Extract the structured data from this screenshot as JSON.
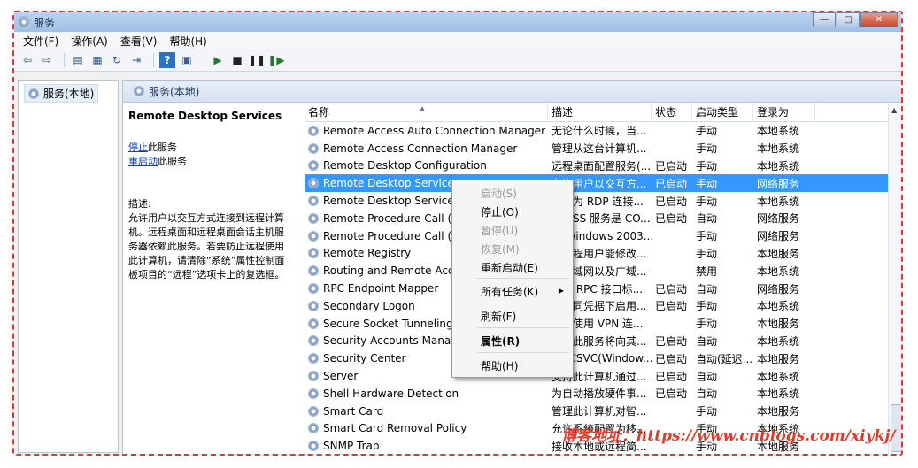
{
  "window": {
    "title": "服务",
    "btn_min": "—",
    "btn_max": "□",
    "btn_close": "✕"
  },
  "menu": [
    "文件(F)",
    "操作(A)",
    "查看(V)",
    "帮助(H)"
  ],
  "tree": {
    "root_label": "服务(本地)"
  },
  "pane": {
    "header": "服务(本地)",
    "selected_service": "Remote Desktop Services",
    "link_stop": "停止",
    "link_stop_suffix": "此服务",
    "link_restart": "重启动",
    "link_restart_suffix": "此服务",
    "desc_label": "描述:",
    "desc_text": "允许用户以交互方式连接到远程计算机。远程桌面和远程桌面会话主机服务器依赖此服务。若要防止远程使用此计算机，请清除“系统”属性控制面板项目的“远程”选项卡上的复选框。"
  },
  "columns": [
    "名称",
    "描述",
    "状态",
    "启动类型",
    "登录为"
  ],
  "rows": [
    {
      "name": "Remote Access Auto Connection Manager",
      "desc": "无论什么时候，当...",
      "status": "",
      "startup": "手动",
      "logon": "本地系统"
    },
    {
      "name": "Remote Access Connection Manager",
      "desc": "管理从这台计算机...",
      "status": "",
      "startup": "手动",
      "logon": "本地系统"
    },
    {
      "name": "Remote Desktop Configuration",
      "desc": "远程桌面配置服务(...",
      "status": "已启动",
      "startup": "手动",
      "logon": "本地系统"
    },
    {
      "name": "Remote Desktop Services",
      "desc": "允许用户以交互方...",
      "status": "已启动",
      "startup": "手动",
      "logon": "网络服务",
      "selected": true
    },
    {
      "name": "Remote Desktop Services U",
      "desc": "允许为 RDP 连接...",
      "status": "已启动",
      "startup": "手动",
      "logon": "本地系统"
    },
    {
      "name": "Remote Procedure Call (RP",
      "desc": "RPCSS 服务是 CO...",
      "status": "已启动",
      "startup": "自动",
      "logon": "网络服务"
    },
    {
      "name": "Remote Procedure Call (RP",
      "desc": "在 Windows 2003...",
      "status": "",
      "startup": "手动",
      "logon": "网络服务"
    },
    {
      "name": "Remote Registry",
      "desc": "使远程用户能修改...",
      "status": "",
      "startup": "手动",
      "logon": "本地服务"
    },
    {
      "name": "Routing and Remote Access",
      "desc": "在局域网以及广域...",
      "status": "",
      "startup": "禁用",
      "logon": "本地系统"
    },
    {
      "name": "RPC Endpoint Mapper",
      "desc": "解析 RPC 接口标...",
      "status": "已启动",
      "startup": "自动",
      "logon": "网络服务"
    },
    {
      "name": "Secondary Logon",
      "desc": "在不同凭据下启用...",
      "status": "已启动",
      "startup": "手动",
      "logon": "本地系统"
    },
    {
      "name": "Secure Socket Tunneling Pr",
      "desc": "提供使用 VPN 连...",
      "status": "",
      "startup": "手动",
      "logon": "本地服务"
    },
    {
      "name": "Security Accounts Manager",
      "desc": "启动此服务将向其...",
      "status": "已启动",
      "startup": "自动",
      "logon": "本地系统"
    },
    {
      "name": "Security Center",
      "desc": "WSCSVC(Window...",
      "status": "已启动",
      "startup": "自动(延迟...",
      "logon": "本地服务"
    },
    {
      "name": "Server",
      "desc": "支持此计算机通过...",
      "status": "已启动",
      "startup": "自动",
      "logon": "本地系统"
    },
    {
      "name": "Shell Hardware Detection",
      "desc": "为自动播放硬件事...",
      "status": "已启动",
      "startup": "自动",
      "logon": "本地系统"
    },
    {
      "name": "Smart Card",
      "desc": "管理此计算机对智...",
      "status": "",
      "startup": "手动",
      "logon": "本地服务"
    },
    {
      "name": "Smart Card Removal Policy",
      "desc": "允许系统配置为移...",
      "status": "",
      "startup": "手动",
      "logon": "本地系统"
    },
    {
      "name": "SNMP Trap",
      "desc": "接收本地或远程简...",
      "status": "",
      "startup": "手动",
      "logon": "本地服务"
    }
  ],
  "context_menu": {
    "start": "启动(S)",
    "stop": "停止(O)",
    "pause": "暂停(U)",
    "resume": "恢复(M)",
    "restart": "重新启动(E)",
    "all_tasks": "所有任务(K)",
    "refresh": "刷新(F)",
    "properties": "属性(R)",
    "help": "帮助(H)"
  },
  "watermark": "博客地址：https://www.cnblogs.com/xiykj/"
}
